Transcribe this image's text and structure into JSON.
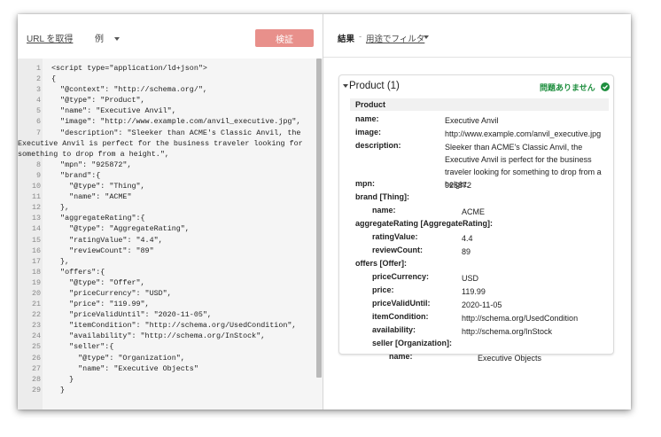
{
  "toolbar": {
    "fetch_url": "URL を取得",
    "example_label": "例",
    "validate_label": "検証"
  },
  "code": [
    {
      "n": "1",
      "t": "<script type=\"application/ld+json\">"
    },
    {
      "n": "2",
      "t": "{"
    },
    {
      "n": "3",
      "t": "  \"@context\": \"http://schema.org/\","
    },
    {
      "n": "4",
      "t": "  \"@type\": \"Product\","
    },
    {
      "n": "5",
      "t": "  \"name\": \"Executive Anvil\","
    },
    {
      "n": "6",
      "t": "  \"image\": \"http://www.example.com/anvil_executive.jpg\","
    },
    {
      "n": "7",
      "t": "  \"description\": \"Sleeker than ACME's Classic Anvil, the\nExecutive Anvil is perfect for the business traveler looking for\nsomething to drop from a height.\","
    },
    {
      "n": "8",
      "t": "  \"mpn\": \"925872\","
    },
    {
      "n": "9",
      "t": "  \"brand\":{"
    },
    {
      "n": "10",
      "t": "    \"@type\": \"Thing\","
    },
    {
      "n": "11",
      "t": "    \"name\": \"ACME\""
    },
    {
      "n": "12",
      "t": "  },"
    },
    {
      "n": "13",
      "t": "  \"aggregateRating\":{"
    },
    {
      "n": "14",
      "t": "    \"@type\": \"AggregateRating\","
    },
    {
      "n": "15",
      "t": "    \"ratingValue\": \"4.4\","
    },
    {
      "n": "16",
      "t": "    \"reviewCount\": \"89\""
    },
    {
      "n": "17",
      "t": "  },"
    },
    {
      "n": "18",
      "t": "  \"offers\":{"
    },
    {
      "n": "19",
      "t": "    \"@type\": \"Offer\","
    },
    {
      "n": "20",
      "t": "    \"priceCurrency\": \"USD\","
    },
    {
      "n": "21",
      "t": "    \"price\": \"119.99\","
    },
    {
      "n": "22",
      "t": "    \"priceValidUntil\": \"2020-11-05\","
    },
    {
      "n": "23",
      "t": "    \"itemCondition\": \"http://schema.org/UsedCondition\","
    },
    {
      "n": "24",
      "t": "    \"availability\": \"http://schema.org/InStock\","
    },
    {
      "n": "25",
      "t": "    \"seller\":{"
    },
    {
      "n": "26",
      "t": "      \"@type\": \"Organization\","
    },
    {
      "n": "27",
      "t": "      \"name\": \"Executive Objects\""
    },
    {
      "n": "28",
      "t": "    }"
    },
    {
      "n": "29",
      "t": "  }"
    }
  ],
  "results": {
    "label": "結果",
    "separator": "-",
    "filter_label": "用途でフィルタ",
    "item_title": "Product (1)",
    "status": "問題ありません",
    "object_type": "Product",
    "properties": [
      {
        "level": 0,
        "key": "name:",
        "value": "Executive Anvil"
      },
      {
        "level": 0,
        "key": "image:",
        "value": "http://www.example.com/anvil_executive.jpg"
      },
      {
        "level": 0,
        "key": "description:",
        "value": "Sleeker than ACME's Classic Anvil, the Executive Anvil is perfect for the business traveler looking for something to drop from a height."
      },
      {
        "level": 0,
        "key": "mpn:",
        "value": "925872"
      },
      {
        "level": 0,
        "key": "brand [Thing]:",
        "value": ""
      },
      {
        "level": 1,
        "key": "name:",
        "value": "ACME"
      },
      {
        "level": 0,
        "key": "aggregateRating [AggregateRating]:",
        "value": ""
      },
      {
        "level": 1,
        "key": "ratingValue:",
        "value": "4.4"
      },
      {
        "level": 1,
        "key": "reviewCount:",
        "value": "89"
      },
      {
        "level": 0,
        "key": "offers [Offer]:",
        "value": ""
      },
      {
        "level": 1,
        "key": "priceCurrency:",
        "value": "USD"
      },
      {
        "level": 1,
        "key": "price:",
        "value": "119.99"
      },
      {
        "level": 1,
        "key": "priceValidUntil:",
        "value": "2020-11-05"
      },
      {
        "level": 1,
        "key": "itemCondition:",
        "value": "http://schema.org/UsedCondition"
      },
      {
        "level": 1,
        "key": "availability:",
        "value": "http://schema.org/InStock"
      },
      {
        "level": 1,
        "key": "seller [Organization]:",
        "value": ""
      },
      {
        "level": 2,
        "key": "name:",
        "value": "Executive Objects"
      }
    ]
  },
  "colors": {
    "validate_button": "#e8908b",
    "status_green": "#1e8e3e"
  },
  "icons": {
    "status": "check-circle-icon",
    "expand": "triangle-down-icon"
  }
}
